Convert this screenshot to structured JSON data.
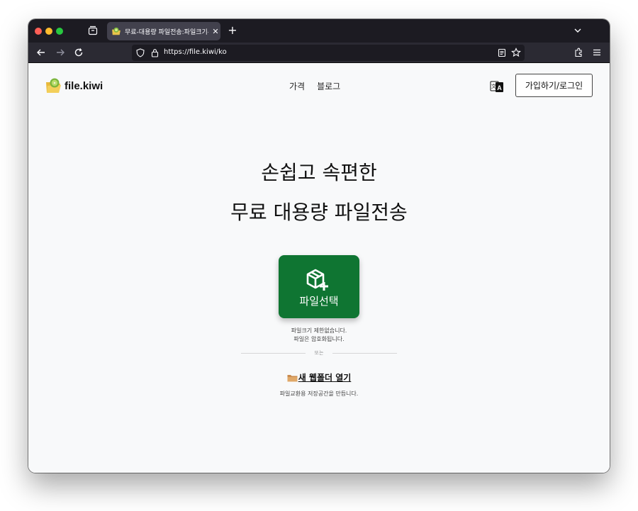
{
  "browser": {
    "tab_title": "무료-대용량 파일전송:파일크기무제한",
    "tab_close": "✕",
    "new_tab": "+",
    "url_scheme": "https://",
    "url_host": "file.kiwi",
    "url_path": "/ko"
  },
  "header": {
    "logo_text": "file.kiwi",
    "menu": [
      "가격",
      "블로그"
    ],
    "login_label": "가입하기/로그인"
  },
  "hero": {
    "line1": "손쉽고 속편한",
    "line2": "무료 대용량 파일전송"
  },
  "upload": {
    "button_label": "파일선택",
    "note1": "파일크기 제한없습니다.",
    "note2": "파일은 암호화됩니다.",
    "or_label": "또는"
  },
  "webfolder": {
    "link_label": "새 웹폴더 열기",
    "description": "파일교환용 저장공간을 만듭니다."
  },
  "colors": {
    "primary_green": "#0f7532",
    "browser_chrome": "#1c1b22",
    "page_bg": "#f8f9fa"
  }
}
